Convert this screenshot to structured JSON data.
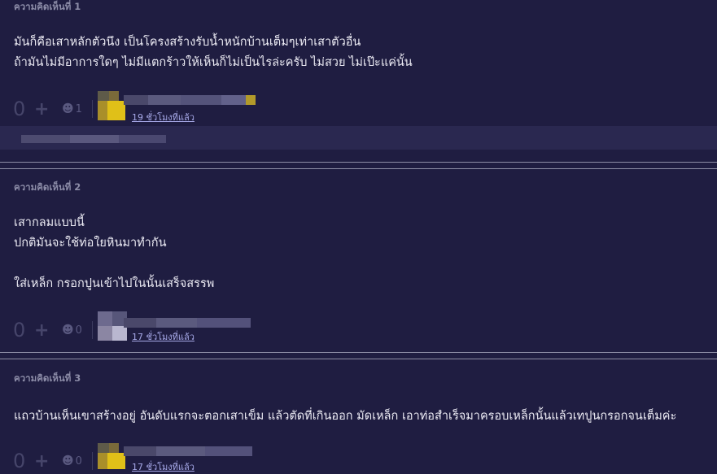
{
  "comments": [
    {
      "label": "ความคิดเห็นที่ 1",
      "lines": [
        "มันก็คือเสาหลักตัวนึง เป็นโครงสร้างรับน้ำหนักบ้านเต็มๆเท่าเสาตัวอื่น",
        "ถ้ามันไม่มีอาการใดๆ ไม่มีแตกร้าวให้เห็นก็ไม่เป็นไรล่ะครับ ไม่สวย ไม่เป๊ะแค่นั้น"
      ],
      "score": "0",
      "emotion_count": "1",
      "time": "19 ชั่วโมงที่แล้ว"
    },
    {
      "label": "ความคิดเห็นที่ 2",
      "lines": [
        "เสากลมแบบนี้",
        "ปกติมันจะใช้ท่อใยหินมาทำกัน",
        "",
        "ใส่เหล็ก กรอกปูนเข้าไปในนั้นเสร็จสรรพ"
      ],
      "score": "0",
      "emotion_count": "0",
      "time": "17 ชั่วโมงที่แล้ว"
    },
    {
      "label": "ความคิดเห็นที่ 3",
      "lines": [
        "แถวบ้านเห็นเขาสร้างอยู่ อันดับแรกจะตอกเสาเข็ม แล้วตัดที่เกินออก มัดเหล็ก เอาท่อสำเร็จมาครอบเหล็กนั้นแล้วเทปูนกรอกจนเต็มค่ะ"
      ],
      "score": "0",
      "emotion_count": "0",
      "time": "17 ชั่วโมงที่แล้ว"
    }
  ],
  "icons": {
    "plus": "+",
    "emotion": "☻"
  },
  "colors": {
    "background": "#1f1d41",
    "label": "#8d8da8",
    "link": "#a7a9e8"
  }
}
